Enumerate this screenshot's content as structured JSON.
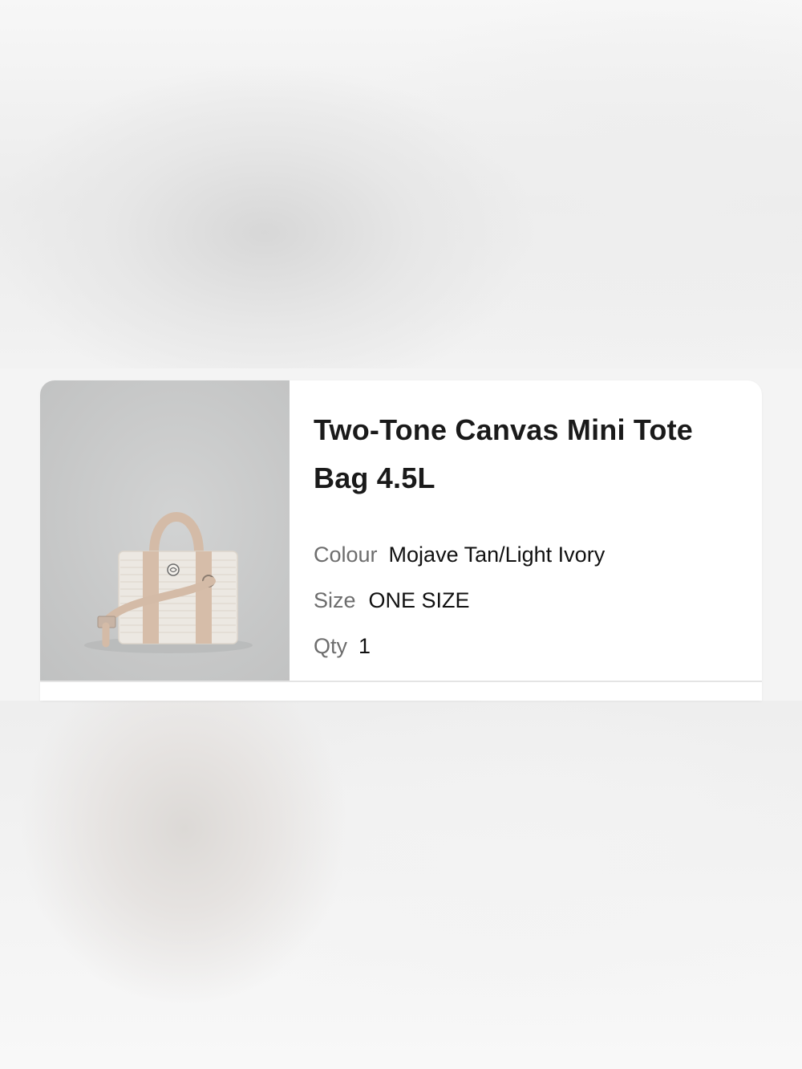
{
  "product": {
    "title": "Two-Tone Canvas Mini Tote Bag 4.5L",
    "colour_label": "Colour",
    "colour_value": "Mojave Tan/Light Ivory",
    "size_label": "Size",
    "size_value": "ONE SIZE",
    "qty_label": "Qty",
    "qty_value": "1",
    "image_description_icon": "tote-bag-product-photo"
  },
  "colors": {
    "card_bg": "#ffffff",
    "image_bg": "#c8c9c9",
    "bag_tan": "#d4bba9",
    "bag_ivory": "#ece8e2",
    "label_gray": "#6d6d6d",
    "text": "#111111"
  }
}
